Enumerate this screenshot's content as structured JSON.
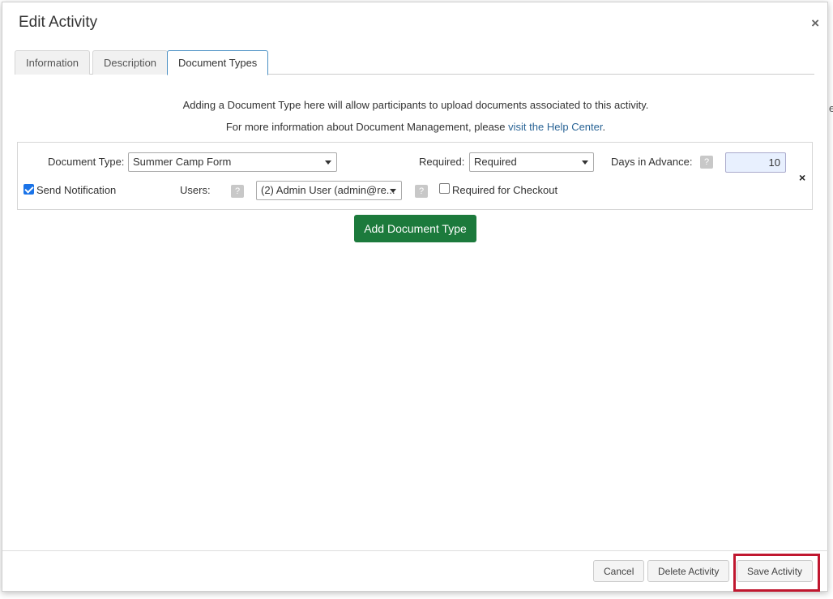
{
  "modal": {
    "title": "Edit Activity",
    "close_glyph": "×"
  },
  "edge_glyph": "e",
  "tabs": [
    {
      "label": "Information",
      "active": false
    },
    {
      "label": "Description",
      "active": false
    },
    {
      "label": "Document Types",
      "active": true
    }
  ],
  "info": {
    "line1": "Adding a Document Type here will allow participants to upload documents associated to this activity.",
    "line2_prefix": "For more information about Document Management, please ",
    "line2_link": "visit the Help Center",
    "line2_suffix": "."
  },
  "document_row": {
    "document_type_label": "Document Type:",
    "document_type_value": "Summer Camp Form",
    "required_label": "Required:",
    "required_value": "Required",
    "days_in_advance_label": "Days in Advance:",
    "days_in_advance_value": "10",
    "help_glyph": "?",
    "send_notification_label": "Send Notification",
    "send_notification_checked": true,
    "users_label": "Users:",
    "users_value": "(2) Admin User (admin@re...",
    "required_for_checkout_label": "Required for Checkout",
    "required_for_checkout_checked": false,
    "remove_glyph": "×"
  },
  "add_document_type_label": "Add Document Type",
  "footer": {
    "cancel_label": "Cancel",
    "delete_label": "Delete Activity",
    "save_label": "Save Activity"
  },
  "colors": {
    "accent_green": "#1c7a3c",
    "highlight_red": "#c0172f",
    "link_blue": "#2a6496"
  },
  "icons": {
    "close": "close-icon",
    "help": "question-mark-icon",
    "dropdown": "chevron-down-icon",
    "remove": "remove-row-icon"
  }
}
